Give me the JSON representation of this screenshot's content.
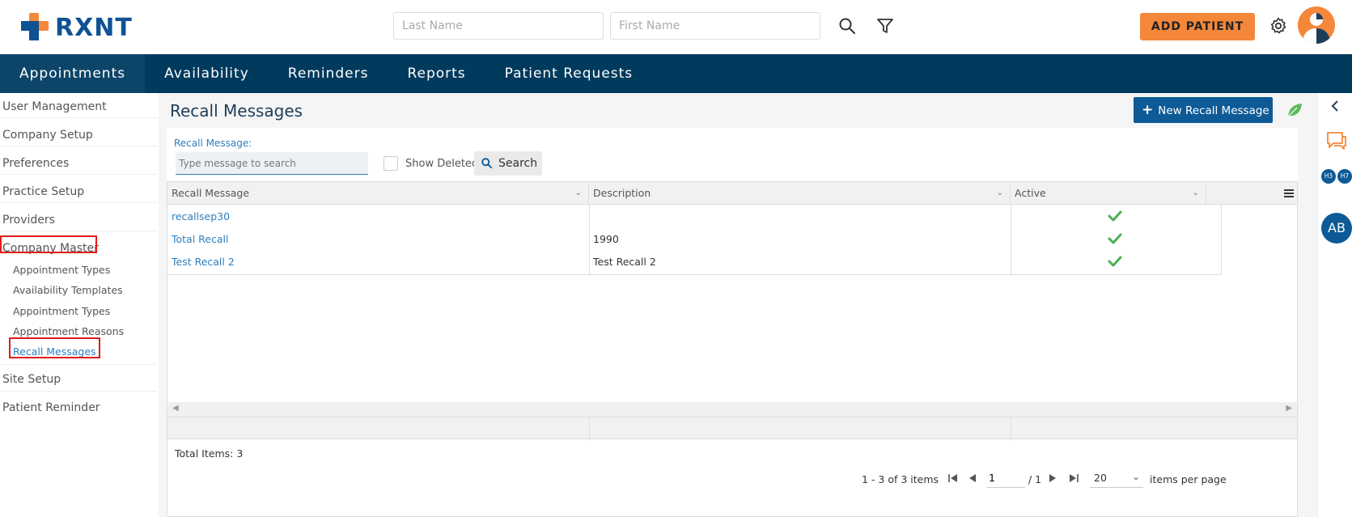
{
  "brand": {
    "name": "RXNT"
  },
  "header": {
    "last_name_placeholder": "Last Name",
    "first_name_placeholder": "First Name",
    "add_patient_label": "ADD PATIENT"
  },
  "nav": {
    "items": [
      {
        "label": "Appointments"
      },
      {
        "label": "Availability"
      },
      {
        "label": "Reminders"
      },
      {
        "label": "Reports"
      },
      {
        "label": "Patient Requests"
      }
    ]
  },
  "sidebar": {
    "user_management": "User Management",
    "company_setup": "Company Setup",
    "preferences": "Preferences",
    "practice_setup": "Practice Setup",
    "providers": "Providers",
    "company_master": "Company Master",
    "sub": {
      "appointment_types_1": "Appointment Types",
      "availability_templates": "Availability Templates",
      "appointment_types_2": "Appointment Types",
      "appointment_reasons": "Appointment Reasons",
      "recall_messages": "Recall Messages"
    },
    "site_setup": "Site Setup",
    "patient_reminder": "Patient Reminder"
  },
  "main": {
    "title": "Recall Messages",
    "new_button_label": "New Recall Message",
    "filter": {
      "label": "Recall Message:",
      "placeholder": "Type message to search",
      "show_deleted_label": "Show Deleted",
      "search_label": "Search"
    },
    "grid": {
      "columns": [
        "Recall Message",
        "Description",
        "Active"
      ],
      "rows": [
        {
          "message": "recallsep30",
          "description": "",
          "active": true
        },
        {
          "message": "Total Recall",
          "description": "1990",
          "active": true
        },
        {
          "message": "Test Recall 2",
          "description": "Test Recall 2",
          "active": true
        }
      ],
      "total_items": "Total Items: 3",
      "range_text": "1 - 3 of 3 items",
      "current_page": "1",
      "total_pages": "/ 1",
      "per_page": "20",
      "per_page_label": "items per page"
    }
  },
  "rail": {
    "badge_1": "H3",
    "badge_2": "H7",
    "avatar_initials": "AB"
  },
  "colors": {
    "nav_bg": "#003a5d",
    "accent_orange": "#f48739",
    "primary_blue": "#0d5a96",
    "link_blue": "#2c7fbf",
    "check_green": "#4caf50"
  }
}
